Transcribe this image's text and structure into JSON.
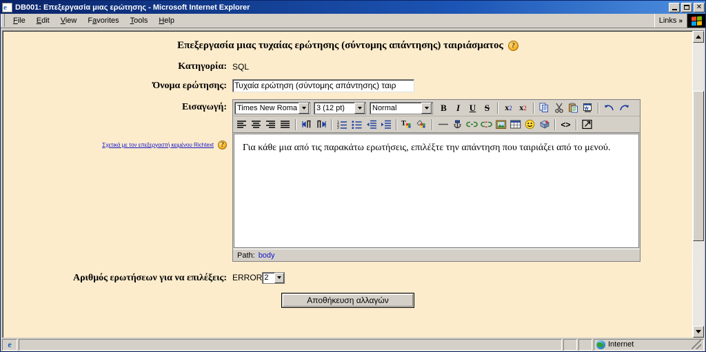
{
  "window": {
    "title": "DB001: Επεξεργασία μιας ερώτησης - Microsoft Internet Explorer",
    "app_icon": "internet-explorer-icon",
    "controls": {
      "minimize": "_",
      "maximize": "□",
      "close": "✕"
    }
  },
  "menubar": {
    "items": [
      {
        "label": "File",
        "accel": "F"
      },
      {
        "label": "Edit",
        "accel": "E"
      },
      {
        "label": "View",
        "accel": "V"
      },
      {
        "label": "Favorites",
        "accel": "a"
      },
      {
        "label": "Tools",
        "accel": "T"
      },
      {
        "label": "Help",
        "accel": "H"
      }
    ],
    "links_label": "Links",
    "chevron": "»"
  },
  "page": {
    "heading": "Επεξεργασία μιας τυχαίας ερώτησης (σύντομης απάντησης) ταιριάσματος",
    "heading_help_icon": "help-question-icon",
    "fields": {
      "category_label": "Κατηγορία:",
      "category_value": "SQL",
      "name_label": "Όνομα ερώτησης:",
      "name_value": "Τυχαία ερώτηση (σύντομης απάντησης) ταιρ",
      "intro_label": "Εισαγωγή:",
      "count_label": "Αριθμός ερωτήσεων για να επιλέξεις:",
      "count_error": "ERROR",
      "count_value": "2"
    },
    "richtext_help": {
      "link_text": "Σχετικά με τον επεξεργαστή κειμένου Richtext",
      "icon": "help-question-icon"
    },
    "editor": {
      "font_family": "Times New Roman",
      "font_size": "3 (12 pt)",
      "paragraph_style": "Normal",
      "body_text": "Για κάθε μια από τις παρακάτω ερωτήσεις, επιλέξτε την απάντηση που ταιριάζει από το μενού.",
      "path_label": "Path:",
      "path_value": "body",
      "toolbar_row1": [
        "bold-icon",
        "italic-icon",
        "underline-icon",
        "strikethrough-icon",
        "subscript-icon",
        "superscript-icon",
        "copy-icon",
        "cut-icon",
        "paste-icon",
        "paste-word-icon",
        "undo-icon",
        "redo-icon"
      ],
      "toolbar_row2": [
        "align-left-icon",
        "align-center-icon",
        "align-right-icon",
        "align-justify-icon",
        "direction-ltr-icon",
        "direction-rtl-icon",
        "ordered-list-icon",
        "unordered-list-icon",
        "outdent-icon",
        "indent-icon",
        "text-color-icon",
        "background-color-icon",
        "horizontal-rule-icon",
        "anchor-icon",
        "insert-link-icon",
        "unlink-icon",
        "insert-image-icon",
        "insert-table-icon",
        "emoticon-icon",
        "insert-media-icon",
        "html-source-icon",
        "fullscreen-icon"
      ]
    },
    "save_button": "Αποθήκευση αλλαγών"
  },
  "statusbar": {
    "main_text": "",
    "zone_text": "Internet",
    "zone_icon": "globe-icon",
    "app_icon": "internet-explorer-icon"
  },
  "colors": {
    "page_background": "#fceccc",
    "chrome": "#d4d0c8",
    "title_start": "#0a246a",
    "title_end": "#4d8fe0",
    "link": "#1414c8"
  }
}
